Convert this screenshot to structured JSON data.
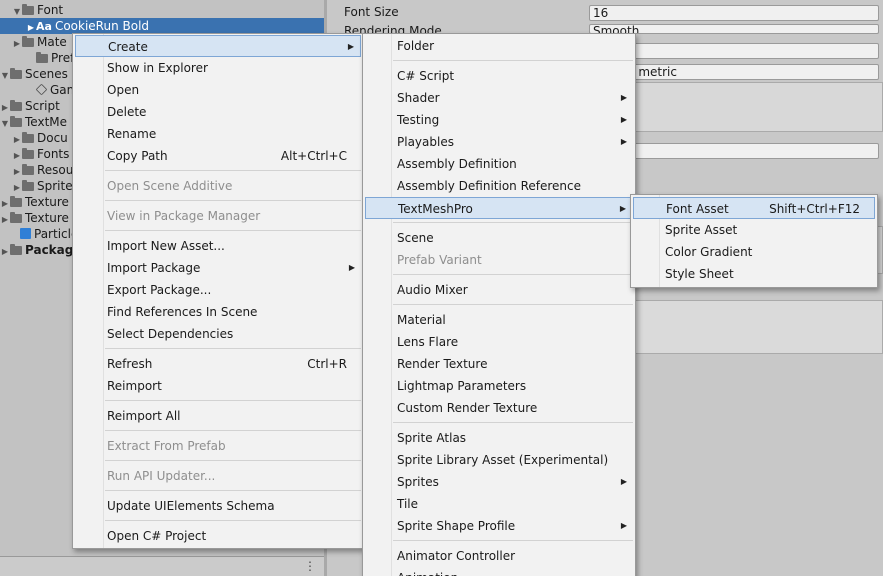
{
  "project": {
    "tree": [
      {
        "arrow": "▼",
        "icon": "folder",
        "label": "Font"
      },
      {
        "arrow": "▶",
        "icon": "font",
        "font_glyph": "Aa",
        "label": "CookieRun Bold",
        "selected": true
      },
      {
        "arrow": "▶",
        "icon": "folder",
        "label": "Mate"
      },
      {
        "arrow": "",
        "icon": "folder",
        "label": "Prefa"
      },
      {
        "arrow": "▼",
        "icon": "folder",
        "label": "Scenes"
      },
      {
        "arrow": "",
        "icon": "scene",
        "label": "Game"
      },
      {
        "arrow": "▶",
        "icon": "folder",
        "label": "Script"
      },
      {
        "arrow": "▼",
        "icon": "folder",
        "label": "TextMe"
      },
      {
        "arrow": "▶",
        "icon": "folder",
        "label": "Docu"
      },
      {
        "arrow": "▶",
        "icon": "folder",
        "label": "Fonts"
      },
      {
        "arrow": "▶",
        "icon": "folder",
        "label": "Resou"
      },
      {
        "arrow": "▶",
        "icon": "folder",
        "label": "Sprite"
      },
      {
        "arrow": "▶",
        "icon": "folder",
        "label": "Texture"
      },
      {
        "arrow": "▶",
        "icon": "folder",
        "label": "Texture"
      },
      {
        "arrow": "",
        "icon": "cube",
        "label": "Particle"
      },
      {
        "arrow": "▶",
        "icon": "folder",
        "label": "Packages",
        "bold": true
      }
    ],
    "footer_menu": "⋮"
  },
  "inspector": {
    "font_size_label": "Font Size",
    "font_size_value": "16",
    "rendering_mode_label": "Rendering Mode",
    "rendering_mode_value": "Smooth",
    "field3_value": "c",
    "field4_value": "cender metric",
    "field5_value": "un"
  },
  "context_menu": {
    "items": [
      {
        "type": "item",
        "label": "Create",
        "submenu": true,
        "highlighted": true
      },
      {
        "type": "item",
        "label": "Show in Explorer"
      },
      {
        "type": "item",
        "label": "Open"
      },
      {
        "type": "item",
        "label": "Delete"
      },
      {
        "type": "item",
        "label": "Rename"
      },
      {
        "type": "item",
        "label": "Copy Path",
        "shortcut": "Alt+Ctrl+C"
      },
      {
        "type": "sep"
      },
      {
        "type": "item",
        "label": "Open Scene Additive",
        "disabled": true
      },
      {
        "type": "sep"
      },
      {
        "type": "item",
        "label": "View in Package Manager",
        "disabled": true
      },
      {
        "type": "sep"
      },
      {
        "type": "item",
        "label": "Import New Asset..."
      },
      {
        "type": "item",
        "label": "Import Package",
        "submenu": true
      },
      {
        "type": "item",
        "label": "Export Package..."
      },
      {
        "type": "item",
        "label": "Find References In Scene"
      },
      {
        "type": "item",
        "label": "Select Dependencies"
      },
      {
        "type": "sep"
      },
      {
        "type": "item",
        "label": "Refresh",
        "shortcut": "Ctrl+R"
      },
      {
        "type": "item",
        "label": "Reimport"
      },
      {
        "type": "sep"
      },
      {
        "type": "item",
        "label": "Reimport All"
      },
      {
        "type": "sep"
      },
      {
        "type": "item",
        "label": "Extract From Prefab",
        "disabled": true
      },
      {
        "type": "sep"
      },
      {
        "type": "item",
        "label": "Run API Updater...",
        "disabled": true
      },
      {
        "type": "sep"
      },
      {
        "type": "item",
        "label": "Update UIElements Schema"
      },
      {
        "type": "sep"
      },
      {
        "type": "item",
        "label": "Open C# Project"
      }
    ]
  },
  "create_menu": {
    "items": [
      {
        "type": "item",
        "label": "Folder"
      },
      {
        "type": "sep"
      },
      {
        "type": "item",
        "label": "C# Script"
      },
      {
        "type": "item",
        "label": "Shader",
        "submenu": true
      },
      {
        "type": "item",
        "label": "Testing",
        "submenu": true
      },
      {
        "type": "item",
        "label": "Playables",
        "submenu": true
      },
      {
        "type": "item",
        "label": "Assembly Definition"
      },
      {
        "type": "item",
        "label": "Assembly Definition Reference"
      },
      {
        "type": "item",
        "label": "TextMeshPro",
        "submenu": true,
        "highlighted": true
      },
      {
        "type": "sep"
      },
      {
        "type": "item",
        "label": "Scene"
      },
      {
        "type": "item",
        "label": "Prefab Variant",
        "disabled": true
      },
      {
        "type": "sep"
      },
      {
        "type": "item",
        "label": "Audio Mixer"
      },
      {
        "type": "sep"
      },
      {
        "type": "item",
        "label": "Material"
      },
      {
        "type": "item",
        "label": "Lens Flare"
      },
      {
        "type": "item",
        "label": "Render Texture"
      },
      {
        "type": "item",
        "label": "Lightmap Parameters"
      },
      {
        "type": "item",
        "label": "Custom Render Texture"
      },
      {
        "type": "sep"
      },
      {
        "type": "item",
        "label": "Sprite Atlas"
      },
      {
        "type": "item",
        "label": "Sprite Library Asset (Experimental)"
      },
      {
        "type": "item",
        "label": "Sprites",
        "submenu": true
      },
      {
        "type": "item",
        "label": "Tile"
      },
      {
        "type": "item",
        "label": "Sprite Shape Profile",
        "submenu": true
      },
      {
        "type": "sep"
      },
      {
        "type": "item",
        "label": "Animator Controller"
      },
      {
        "type": "item",
        "label": "Animation"
      }
    ]
  },
  "tmp_menu": {
    "items": [
      {
        "type": "item",
        "label": "Font Asset",
        "shortcut": "Shift+Ctrl+F12",
        "highlighted": true
      },
      {
        "type": "item",
        "label": "Sprite Asset"
      },
      {
        "type": "item",
        "label": "Color Gradient"
      },
      {
        "type": "item",
        "label": "Style Sheet"
      }
    ]
  }
}
